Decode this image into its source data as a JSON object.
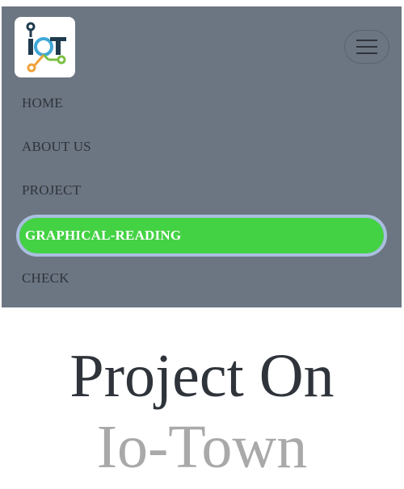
{
  "brand": {
    "logo_text": "IoT",
    "colors": {
      "dark": "#1f3b4d",
      "blue": "#3ea7d8",
      "orange": "#f0a23a",
      "green": "#7bc043"
    }
  },
  "nav": {
    "toggle_icon": "hamburger-icon",
    "items": [
      {
        "label": "HOME",
        "active": false
      },
      {
        "label": "ABOUT US",
        "active": false
      },
      {
        "label": "PROJECT",
        "active": false
      },
      {
        "label": "GRAPHICAL-READING",
        "active": true
      },
      {
        "label": "CHECK",
        "active": false
      }
    ],
    "colors": {
      "background": "#6c7582",
      "active_bg": "#43d243",
      "active_ring": "#a9bfdf"
    }
  },
  "hero": {
    "line1": "Project On",
    "line2": "Io-Town"
  }
}
